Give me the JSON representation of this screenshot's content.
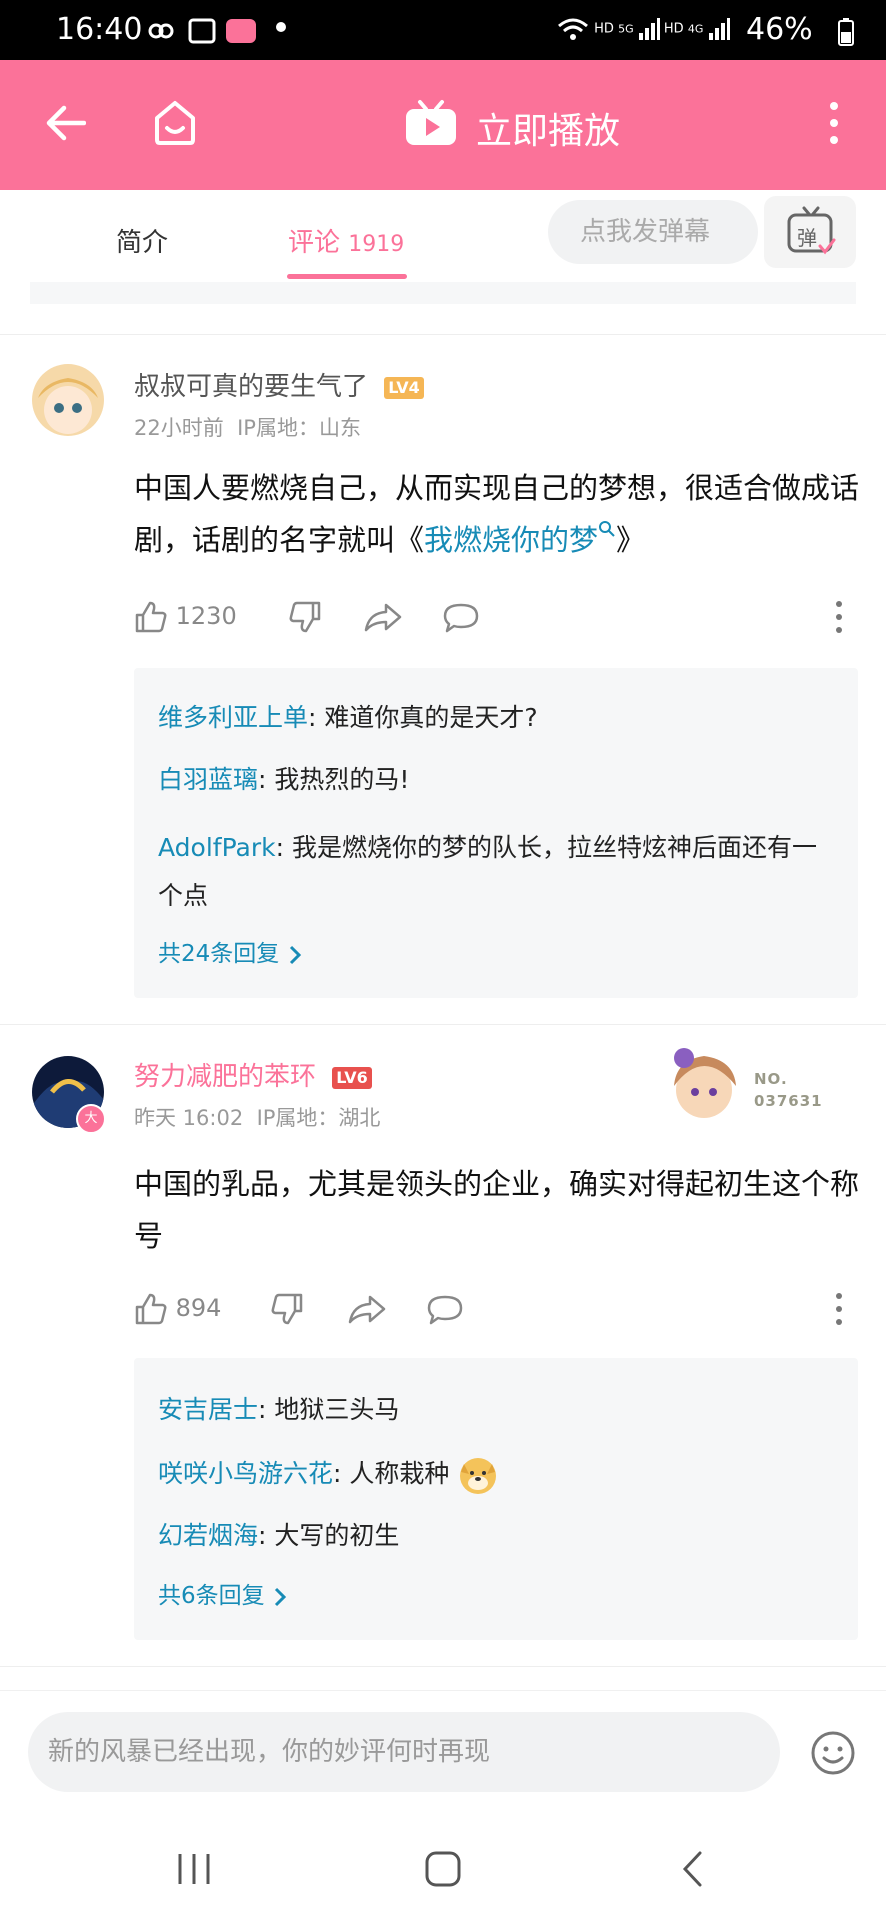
{
  "status_bar": {
    "time": "16:40",
    "net1": "HD",
    "net2": "HD",
    "sig1": "5G",
    "sig2": "4G",
    "battery": "46%"
  },
  "header": {
    "title": "立即播放",
    "brand_color": "#fb7299"
  },
  "tabs": {
    "intro": "简介",
    "comments": "评论",
    "comment_count": "1919",
    "danmaku_placeholder": "点我发弹幕",
    "danmaku_btn": "弹"
  },
  "comments": [
    {
      "user": "叔叔可真的要生气了",
      "level": "LV4",
      "time": "22小时前",
      "ip": "IP属地：山东",
      "content_prefix": "中国人要燃烧自己，从而实现自己的梦想，很适合做成话剧，话剧的名字就叫《",
      "content_link": "我燃烧你的梦",
      "content_suffix": "》",
      "likes": "1230",
      "replies": [
        {
          "name": "维多利亚上单",
          "text": ": 难道你真的是天才?"
        },
        {
          "name": "白羽蓝璃",
          "text": ": 我热烈的马!"
        },
        {
          "name": "AdolfPark",
          "text": ": 我是燃烧你的梦的队长，拉丝特炫神后面还有一个点"
        }
      ],
      "more_replies": "共24条回复"
    },
    {
      "user": "努力减肥的苯环",
      "level": "LV6",
      "time": "昨天 16:02",
      "ip": "IP属地：湖北",
      "badge_no_label": "NO.",
      "badge_no": "037631",
      "avatar_badge": "大",
      "content": "中国的乳品，尤其是领头的企业，确实对得起初生这个称号",
      "likes": "894",
      "replies": [
        {
          "name": "安吉居士",
          "text": ": 地狱三头马"
        },
        {
          "name": "咲咲小鸟游六花",
          "text": ": 人称栽种"
        },
        {
          "name": "幻若烟海",
          "text": ": 大写的初生"
        }
      ],
      "more_replies": "共6条回复"
    }
  ],
  "bottom": {
    "input_placeholder": "新的风暴已经出现，你的妙评何时再现"
  },
  "icons": [
    "back-arrow-icon",
    "home-icon",
    "tv-play-icon",
    "more-vertical-icon",
    "danmaku-toggle-icon",
    "thumb-up-icon",
    "thumb-down-icon",
    "share-icon",
    "reply-bubble-icon",
    "chevron-right-icon",
    "emoji-icon",
    "search-icon",
    "nav-recent-icon",
    "nav-home-icon",
    "nav-back-icon"
  ]
}
